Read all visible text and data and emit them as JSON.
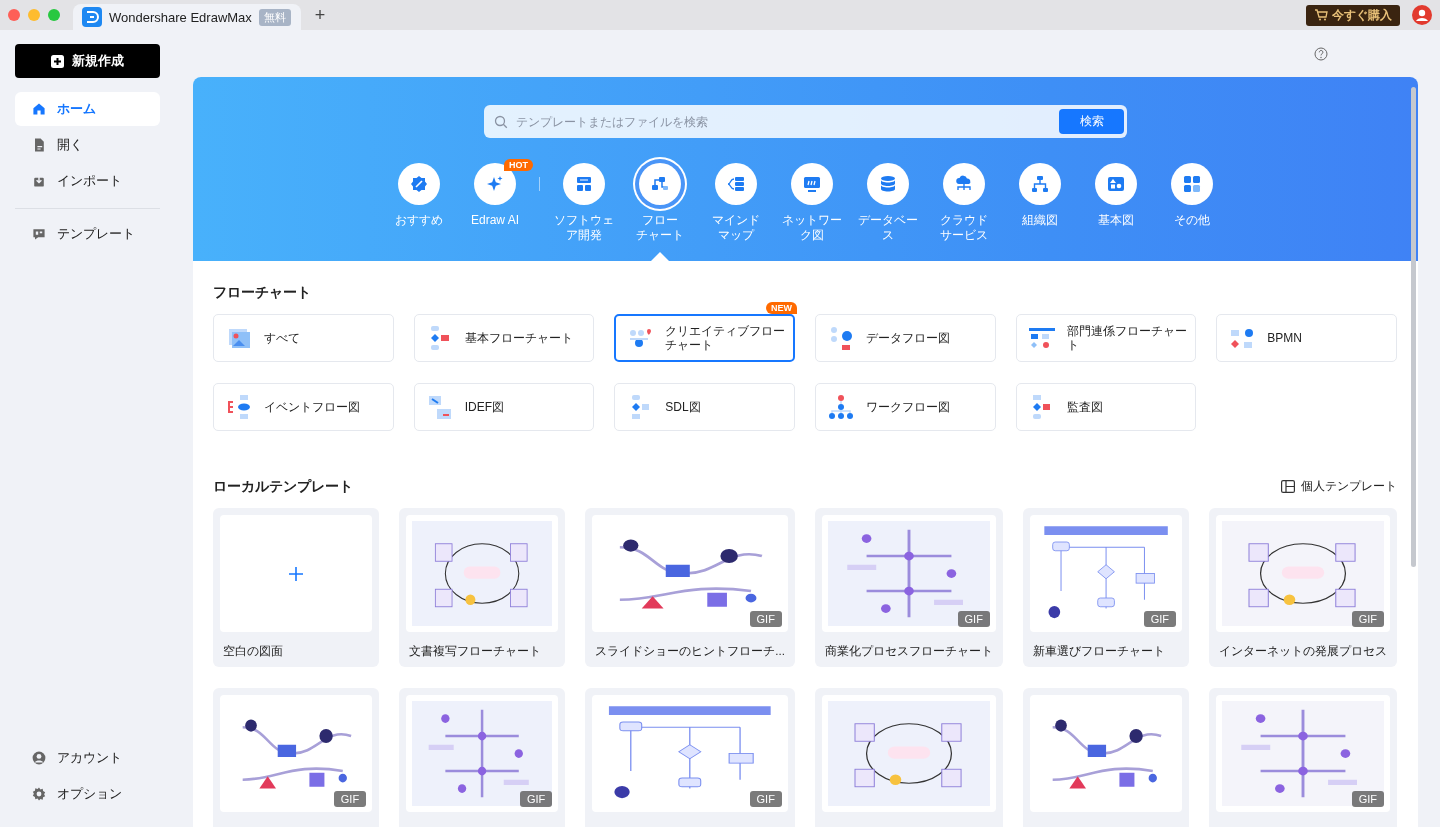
{
  "tab": {
    "title": "Wondershare EdrawMax",
    "badge": "無料",
    "new_tab": "+"
  },
  "buy_button": {
    "label": "今すぐ購入"
  },
  "sidebar": {
    "new_button": "新規作成",
    "sections": [
      {
        "items": [
          {
            "label": "ホーム",
            "selected": true
          },
          {
            "label": "開く",
            "selected": false
          },
          {
            "label": "インポート",
            "selected": false
          }
        ]
      },
      {
        "items": [
          {
            "label": "テンプレート",
            "selected": false
          }
        ]
      }
    ],
    "bottom_items": [
      {
        "label": "アカウント"
      },
      {
        "label": "オプション"
      }
    ]
  },
  "search": {
    "placeholder": "テンプレートまたはファイルを検索",
    "button": "検索"
  },
  "categories": {
    "featured": [
      {
        "label": "おすすめ",
        "selected": false
      },
      {
        "label": "Edraw AI",
        "selected": false,
        "tag": "HOT"
      }
    ],
    "diagram_types": [
      {
        "label_lines": [
          "ソフトウェ",
          "ア開発"
        ],
        "selected": false
      },
      {
        "label_lines": [
          "フロー",
          "チャート"
        ],
        "selected": true
      },
      {
        "label_lines": [
          "マインド",
          "マップ"
        ],
        "selected": false
      },
      {
        "label_lines": [
          "ネットワー",
          "ク図"
        ],
        "selected": false
      },
      {
        "label_lines": [
          "データベー",
          "ス"
        ],
        "selected": false
      },
      {
        "label_lines": [
          "クラウド",
          "サービス"
        ],
        "selected": false
      },
      {
        "label_lines": [
          "組織図"
        ],
        "selected": false
      },
      {
        "label_lines": [
          "基本図"
        ],
        "selected": false
      },
      {
        "label_lines": [
          "その他"
        ],
        "selected": false
      }
    ]
  },
  "flowchart_section": {
    "title": "フローチャート",
    "types": [
      {
        "label": "すべて",
        "selected": false
      },
      {
        "label": "基本フローチャート",
        "selected": false
      },
      {
        "label": "クリエイティブフローチャート",
        "selected": true,
        "tag": "NEW"
      },
      {
        "label": "データフロー図",
        "selected": false
      },
      {
        "label": "部門連係フローチャート",
        "selected": false
      },
      {
        "label": "BPMN",
        "selected": false
      },
      {
        "label": "イベントフロー図",
        "selected": false
      },
      {
        "label": "IDEF図",
        "selected": false
      },
      {
        "label": "SDL図",
        "selected": false
      },
      {
        "label": "ワークフロー図",
        "selected": false
      },
      {
        "label": "監査図",
        "selected": false
      }
    ]
  },
  "local_templates": {
    "title": "ローカルテンプレート",
    "personal_link": "個人テンプレート",
    "items": [
      {
        "kind": "blank",
        "title": "空白の図面"
      },
      {
        "kind": "template",
        "title": "文書複写フローチャート"
      },
      {
        "kind": "template",
        "title": "スライドショーのヒントフローチ...",
        "badge": "GIF"
      },
      {
        "kind": "template",
        "title": "商業化プロセスフローチャート",
        "badge": "GIF"
      },
      {
        "kind": "template",
        "title": "新車選びフローチャート",
        "badge": "GIF"
      },
      {
        "kind": "template",
        "title": "インターネットの発展プロセス",
        "badge": "GIF"
      },
      {
        "kind": "template",
        "badge": "GIF"
      },
      {
        "kind": "template",
        "badge": "GIF"
      },
      {
        "kind": "template",
        "badge": "GIF"
      },
      {
        "kind": "template"
      },
      {
        "kind": "template"
      },
      {
        "kind": "template",
        "badge": "GIF"
      }
    ]
  }
}
